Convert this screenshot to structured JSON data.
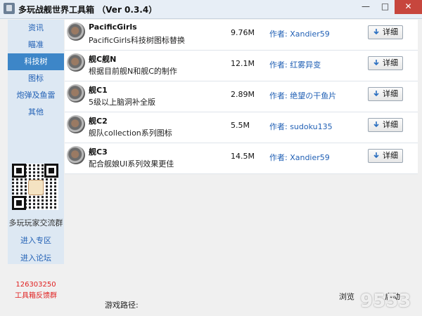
{
  "window": {
    "title": "多玩战舰世界工具箱 （Ver 0.3.4）",
    "minimize_glyph": "—",
    "maximize_glyph": "□",
    "close_glyph": "✕"
  },
  "sidebar": {
    "items": [
      {
        "label": "资讯",
        "active": false
      },
      {
        "label": "瞄准",
        "active": false
      },
      {
        "label": "科技树",
        "active": true
      },
      {
        "label": "图标",
        "active": false
      },
      {
        "label": "炮弹及鱼雷",
        "active": false
      },
      {
        "label": "其他",
        "active": false
      }
    ],
    "group_label": "多玩玩家交流群",
    "links": [
      "进入专区",
      "进入论坛"
    ],
    "contact_number": "126303250",
    "contact_label": "工具箱反馈群"
  },
  "list": {
    "detail_label": "详细",
    "items": [
      {
        "title": "PacificGirls",
        "desc": "PacificGirls科技树图标替换",
        "size": "9.76M",
        "author": "作者: Xandier59"
      },
      {
        "title": "舰C舰N",
        "desc": "根据目前舰N和舰C的制作",
        "size": "12.1M",
        "author": "作者: 红雾异变"
      },
      {
        "title": "舰C1",
        "desc": "5级以上脑洞补全版",
        "size": "2.89M",
        "author": "作者: 绝望の干鱼片"
      },
      {
        "title": "舰C2",
        "desc": "舰队collection系列图标",
        "size": "5.5M",
        "author": "作者: sudoku135"
      },
      {
        "title": "舰C3",
        "desc": "配合舰娘UI系列效果更佳",
        "size": "14.5M",
        "author": "作者: Xandier59"
      }
    ]
  },
  "bottom": {
    "path_label": "游戏路径:",
    "browse_label": "浏览",
    "launch_label": "启动"
  },
  "watermark": "9553",
  "colors": {
    "link": "#2160b5",
    "active_nav": "#3d86c8",
    "close": "#c7463d",
    "contact": "#e02020"
  }
}
